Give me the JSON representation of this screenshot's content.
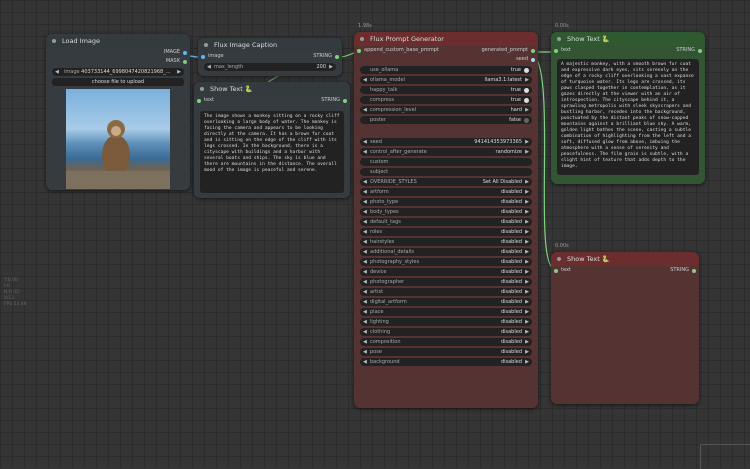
{
  "side_info": [
    "T:0.00",
    "I:0",
    "N:6 [6]",
    "V:13",
    "FPS:53.48"
  ],
  "load_image": {
    "title": "Load Image",
    "outputs": [
      "IMAGE",
      "MASK"
    ],
    "image_value": "403733144_6998047420821968_...",
    "image_label": "image",
    "upload_label": "choose file to upload"
  },
  "caption": {
    "title": "Flux Image Caption",
    "input": "image",
    "output": "STRING",
    "max_length_label": "max_length",
    "max_length_value": "200"
  },
  "show_text_1": {
    "title": "Show Text 🐍",
    "input": "text",
    "output": "STRING",
    "text": "The image shows a monkey sitting on a rocky cliff overlooking a large body of water. The monkey is facing the camera and appears to be looking directly at the camera. It has a brown fur coat and is sitting on the edge of the cliff with its legs crossed. In the background, there is a cityscape with buildings and a harbor with several boats and ships. The sky is blue and there are mountains in the distance. The overall mood of the image is peaceful and serene."
  },
  "prompt_gen": {
    "badge": "1.98s",
    "title": "Flux Prompt Generator",
    "input": "append_custom_base_prompt",
    "output1": "generated_prompt",
    "output2": "seed",
    "widgets": [
      {
        "label": "use_ollama",
        "value": "true",
        "kind": "toggle"
      },
      {
        "label": "ollama_model",
        "value": "llama3.1:latest",
        "kind": "combo"
      },
      {
        "label": "happy_talk",
        "value": "true",
        "kind": "toggle"
      },
      {
        "label": "compress",
        "value": "true",
        "kind": "toggle"
      },
      {
        "label": "compression_level",
        "value": "hard",
        "kind": "combo"
      },
      {
        "label": "poster",
        "value": "false",
        "kind": "toggle"
      }
    ],
    "widgets2": [
      {
        "label": "seed",
        "value": "941414353973365",
        "kind": "number"
      },
      {
        "label": "control_after_generate",
        "value": "randomize",
        "kind": "combo"
      },
      {
        "label": "custom",
        "value": "",
        "kind": "text"
      },
      {
        "label": "subject",
        "value": "",
        "kind": "text"
      },
      {
        "label": "OVERRIDE_STYLES",
        "value": "Set All Disabled",
        "kind": "combo"
      },
      {
        "label": "artform",
        "value": "disabled",
        "kind": "combo"
      },
      {
        "label": "photo_type",
        "value": "disabled",
        "kind": "combo"
      },
      {
        "label": "body_types",
        "value": "disabled",
        "kind": "combo"
      },
      {
        "label": "default_tags",
        "value": "disabled",
        "kind": "combo"
      },
      {
        "label": "roles",
        "value": "disabled",
        "kind": "combo"
      },
      {
        "label": "hairstyles",
        "value": "disabled",
        "kind": "combo"
      },
      {
        "label": "additional_details",
        "value": "disabled",
        "kind": "combo"
      },
      {
        "label": "photography_styles",
        "value": "disabled",
        "kind": "combo"
      },
      {
        "label": "device",
        "value": "disabled",
        "kind": "combo"
      },
      {
        "label": "photographer",
        "value": "disabled",
        "kind": "combo"
      },
      {
        "label": "artist",
        "value": "disabled",
        "kind": "combo"
      },
      {
        "label": "digital_artform",
        "value": "disabled",
        "kind": "combo"
      },
      {
        "label": "place",
        "value": "disabled",
        "kind": "combo"
      },
      {
        "label": "lighting",
        "value": "disabled",
        "kind": "combo"
      },
      {
        "label": "clothing",
        "value": "disabled",
        "kind": "combo"
      },
      {
        "label": "composition",
        "value": "disabled",
        "kind": "combo"
      },
      {
        "label": "pose",
        "value": "disabled",
        "kind": "combo"
      },
      {
        "label": "background",
        "value": "disabled",
        "kind": "combo"
      }
    ]
  },
  "show_text_2": {
    "badge": "0.00s",
    "title": "Show Text 🐍",
    "input": "text",
    "output": "STRING",
    "text": "A majestic monkey, with a smooth brown fur coat and expressive dark eyes, sits serenely on the edge of a rocky cliff overlooking a vast expanse of turquoise water. Its legs are crossed, its paws clasped together in contemplation, as it gazes directly at the viewer with an air of introspection. The cityscape behind it, a sprawling metropolis with sleek skyscrapers and bustling harbor, recedes into the background, punctuated by the distant peaks of snow-capped mountains against a brilliant blue sky. A warm, golden light bathes the scene, casting a subtle combination of highlighting from the left and a soft, diffused glow from above, imbuing the atmosphere with a sense of serenity and peacefulness. The film grain is subtle, with a slight hint of texture that adds depth to the image."
  },
  "show_text_3": {
    "badge": "0.00s",
    "title": "Show Text 🐍",
    "input": "text",
    "output": "STRING"
  },
  "colors": {
    "node_red_header": "#6b2d2d",
    "node_red_body": "#553333",
    "node_green_header": "#2f5a2f",
    "node_green_body": "#335533",
    "node_grey_header": "#333b3f",
    "node_grey_body": "#353b3f",
    "image_dot": "#64b5f6",
    "string_dot": "#7fd27f",
    "int_dot": "#a0d8ef"
  }
}
